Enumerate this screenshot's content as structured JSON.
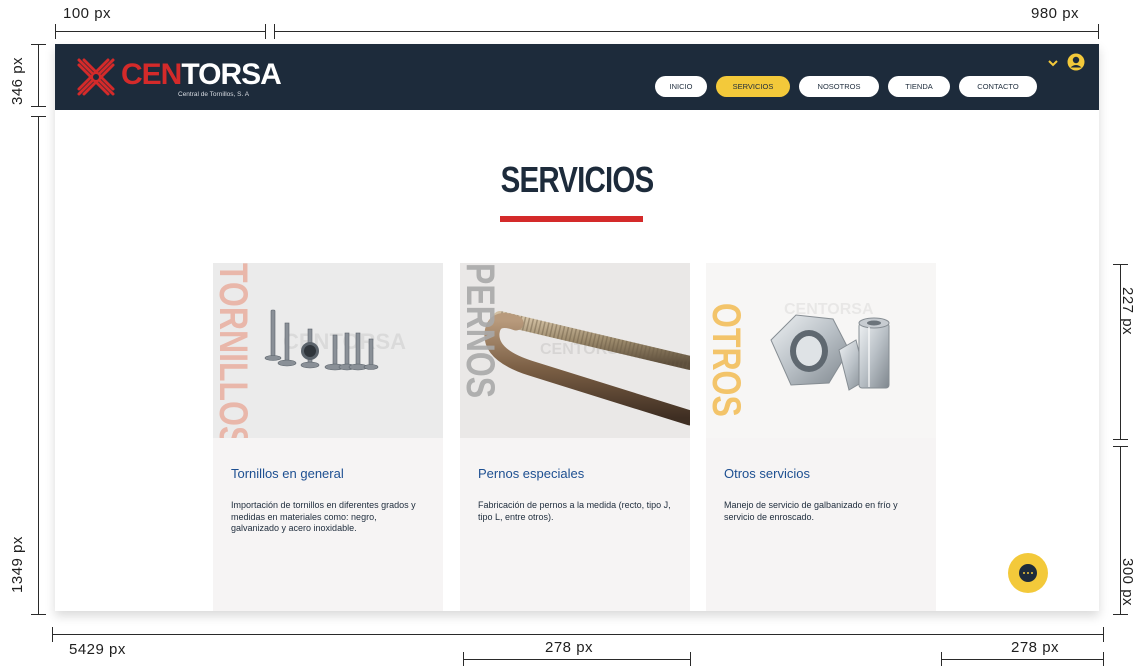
{
  "annotations": {
    "top_left": "100 px",
    "top_right": "980 px",
    "left_top": "346 px",
    "left_bottom": "1349 px",
    "right_top": "227 px",
    "right_bottom": "300 px",
    "bottom_left": "5429 px",
    "bottom_mid": "278 px",
    "bottom_right": "278 px"
  },
  "header": {
    "logo_red": "CEN",
    "logo_white": "TORSA",
    "logo_sub": "Central de Tornillos, S. A",
    "nav": [
      {
        "label": "INICIO",
        "active": false
      },
      {
        "label": "SERVICIOS",
        "active": true
      },
      {
        "label": "NOSOTROS",
        "active": false
      },
      {
        "label": "TIENDA",
        "active": false
      },
      {
        "label": "CONTACTO",
        "active": false
      }
    ],
    "dropdown_icon": "chevron-down-icon",
    "user_icon": "user-icon"
  },
  "main": {
    "title": "SERVICIOS"
  },
  "cards": [
    {
      "vertical_word": "TORNILLOS",
      "watermark": "CENTORSA",
      "title": "Tornillos en general",
      "text": "Importación de tornillos en diferentes grados y medidas en materiales como: negro, galvanizado y acero inoxidable.",
      "word_color": "#e9b7aa"
    },
    {
      "vertical_word": "PERNOS",
      "watermark": "CENTORSA",
      "title": "Pernos especiales",
      "text": "Fabricación de pernos a la medida (recto, tipo J, tipo L, entre otros).",
      "word_color": "#a9a9a9"
    },
    {
      "vertical_word": "OTROS",
      "watermark": "CENTORSA",
      "title": "Otros servicios",
      "text": "Manejo de servicio de galbanizado en frío y servicio de enroscado.",
      "word_color": "#f3c46a"
    }
  ],
  "chat": {
    "icon": "chat-icon"
  },
  "colors": {
    "navy": "#1d2b3b",
    "red": "#d42a2a",
    "yellow": "#f3c93a"
  }
}
